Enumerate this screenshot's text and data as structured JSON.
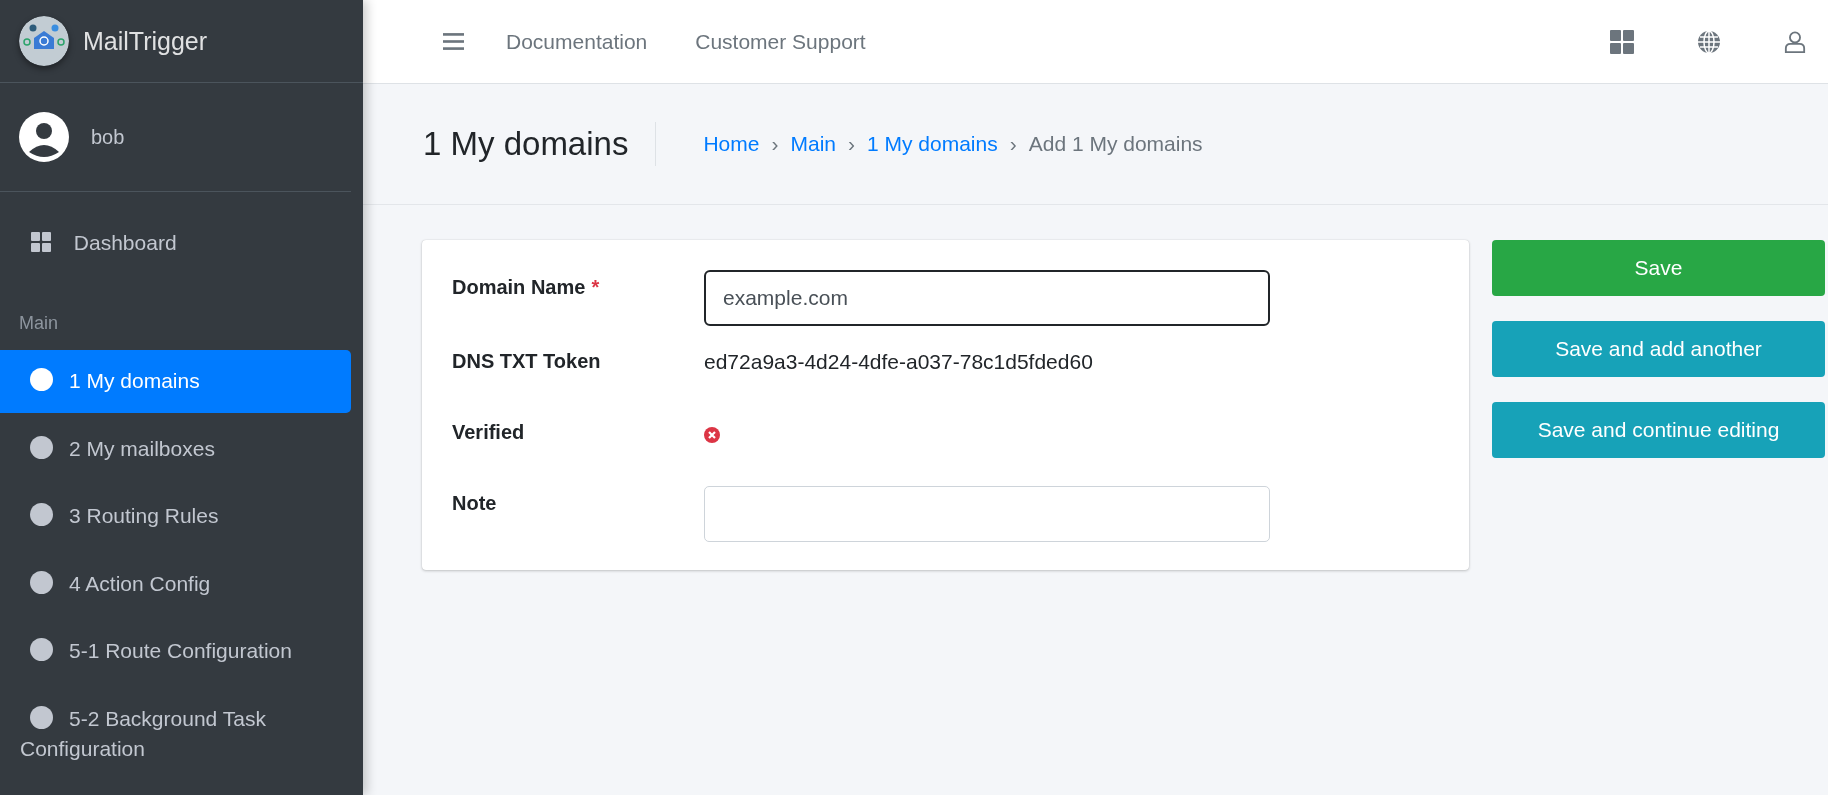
{
  "sidebar": {
    "brand": "MailTrigger",
    "user": "bob",
    "top_items": [
      {
        "kind": "grid",
        "label": "Dashboard",
        "selected": false
      }
    ],
    "section_title": "Main",
    "items": [
      {
        "label": "1 My domains",
        "selected": true
      },
      {
        "label": "2 My mailboxes",
        "selected": false
      },
      {
        "label": "3 Routing Rules",
        "selected": false
      },
      {
        "label": "4 Action Config",
        "selected": false
      },
      {
        "label": "5-1 Route Configuration",
        "selected": false
      },
      {
        "label": "5-2 Background Task Configuration",
        "selected": false
      }
    ]
  },
  "topbar": {
    "links": [
      "Documentation",
      "Customer Support"
    ]
  },
  "page": {
    "title": "1 My domains",
    "breadcrumb": [
      {
        "kind": "link",
        "label": "Home"
      },
      {
        "kind": "separator",
        "label": "›"
      },
      {
        "kind": "link",
        "label": "Main"
      },
      {
        "kind": "separator",
        "label": "›"
      },
      {
        "kind": "link",
        "label": "1 My domains"
      },
      {
        "kind": "separator",
        "label": "›"
      },
      {
        "kind": "current",
        "label": "Add 1 My domains"
      }
    ]
  },
  "form": {
    "fields": [
      {
        "kind": "input",
        "label": "Domain Name",
        "required_mark": "*",
        "value": "example.com",
        "focused": true
      },
      {
        "kind": "text",
        "label": "DNS TXT Token",
        "value": "ed72a9a3-4d24-4dfe-a037-78c1d5fded60"
      },
      {
        "kind": "boolean",
        "label": "Verified",
        "value": false
      },
      {
        "kind": "input",
        "label": "Note",
        "focused": false
      }
    ]
  },
  "actions": [
    {
      "kind": "primary",
      "label": "Save"
    },
    {
      "kind": "secondary",
      "label": "Save and add another"
    },
    {
      "kind": "secondary",
      "label": "Save and continue editing"
    }
  ]
}
